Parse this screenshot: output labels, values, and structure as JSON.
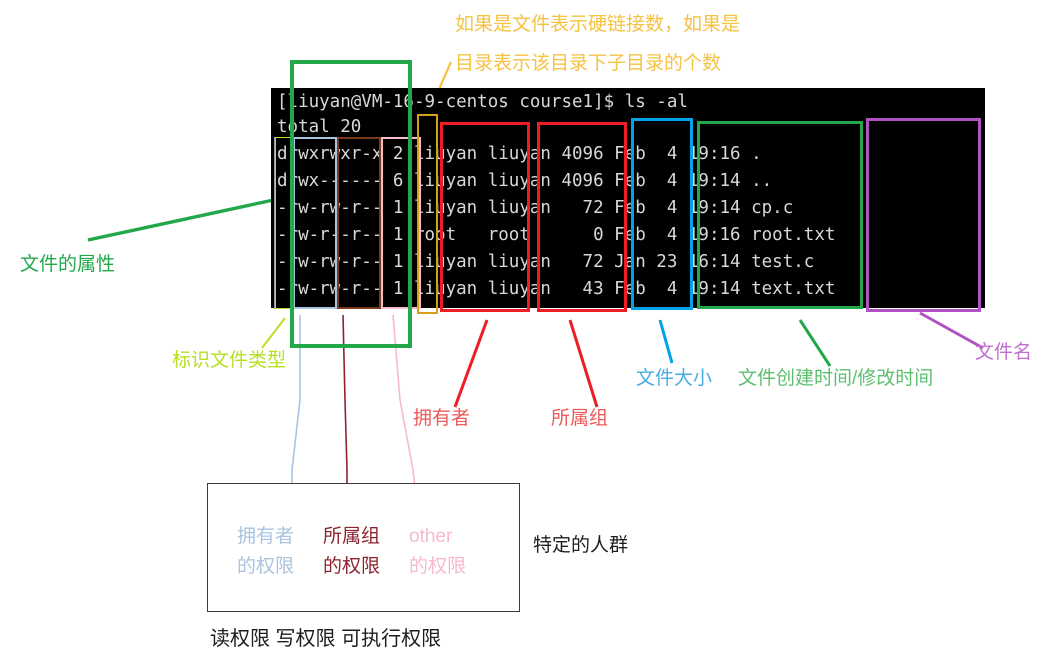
{
  "terminal": {
    "prompt_line": "[liuyan@VM-16-9-centos course1]$ ls -al",
    "total_line": "total 20",
    "rows": [
      {
        "perm": "drwxrwxr-x",
        "links": "2",
        "owner": "liuyan",
        "group": "liuyan",
        "size": "4096",
        "month": "Feb",
        "day": "4",
        "time": "19:16",
        "name": "."
      },
      {
        "perm": "drwx------",
        "links": "6",
        "owner": "liuyan",
        "group": "liuyan",
        "size": "4096",
        "month": "Feb",
        "day": "4",
        "time": "19:14",
        "name": ".."
      },
      {
        "perm": "-rw-rw-r--",
        "links": "1",
        "owner": "liuyan",
        "group": "liuyan",
        "size": "72",
        "month": "Feb",
        "day": "4",
        "time": "19:14",
        "name": "cp.c"
      },
      {
        "perm": "-rw-r--r--",
        "links": "1",
        "owner": "root",
        "group": "root",
        "size": "0",
        "month": "Feb",
        "day": "4",
        "time": "19:16",
        "name": "root.txt"
      },
      {
        "perm": "-rw-rw-r--",
        "links": "1",
        "owner": "liuyan",
        "group": "liuyan",
        "size": "72",
        "month": "Jan",
        "day": "23",
        "time": "16:14",
        "name": "test.c"
      },
      {
        "perm": "-rw-rw-r--",
        "links": "1",
        "owner": "liuyan",
        "group": "liuyan",
        "size": "43",
        "month": "Feb",
        "day": "4",
        "time": "19:14",
        "name": "text.txt"
      }
    ],
    "full_lines": [
      "[liuyan@VM-16-9-centos course1]$ ls -al",
      "total 20",
      "drwxrwxr-x 2 liuyan liuyan 4096 Feb  4 19:16 .",
      "drwx------ 6 liuyan liuyan 4096 Feb  4 19:14 ..",
      "-rw-rw-r-- 1 liuyan liuyan   72 Feb  4 19:14 cp.c",
      "-rw-r--r-- 1 root   root      0 Feb  4 19:16 root.txt",
      "-rw-rw-r-- 1 liuyan liuyan   72 Jan 23 16:14 test.c",
      "-rw-rw-r-- 1 liuyan liuyan   43 Feb  4 19:14 text.txt"
    ]
  },
  "annotations": {
    "link_count_line1": "如果是文件表示硬链接数，如果是",
    "link_count_line2": "目录表示该目录下子目录的个数",
    "file_attributes": "文件的属性",
    "file_type_flag": "标识文件类型",
    "owner": "拥有者",
    "group": "所属组",
    "file_size": "文件大小",
    "file_time": "文件创建时间/修改时间",
    "file_name": "文件名"
  },
  "legend": {
    "owner_perm_l1": "拥有者",
    "owner_perm_l2": "的权限",
    "group_perm_l1": "所属组",
    "group_perm_l2": "的权限",
    "other_perm_l1": "other",
    "other_perm_l2": "的权限",
    "specific_people": "特定的人群",
    "perm_kinds": "读权限  写权限  可执行权限"
  },
  "colors": {
    "amber": "#f5c242",
    "green": "#22a84a",
    "yellow_green": "#b7e021",
    "red": "#ee1c24",
    "blue": "#00a2e8",
    "purple": "#b152c4",
    "light_blue": "#a8c4e0",
    "dark_red": "#8c2430",
    "pink": "#f7b9cd",
    "brown": "#7a3b18",
    "gray_box": "#9a9a9a",
    "terminal_bg": "#000000",
    "terminal_fg": "#d8d8d8",
    "black": "#1e1e1e"
  }
}
